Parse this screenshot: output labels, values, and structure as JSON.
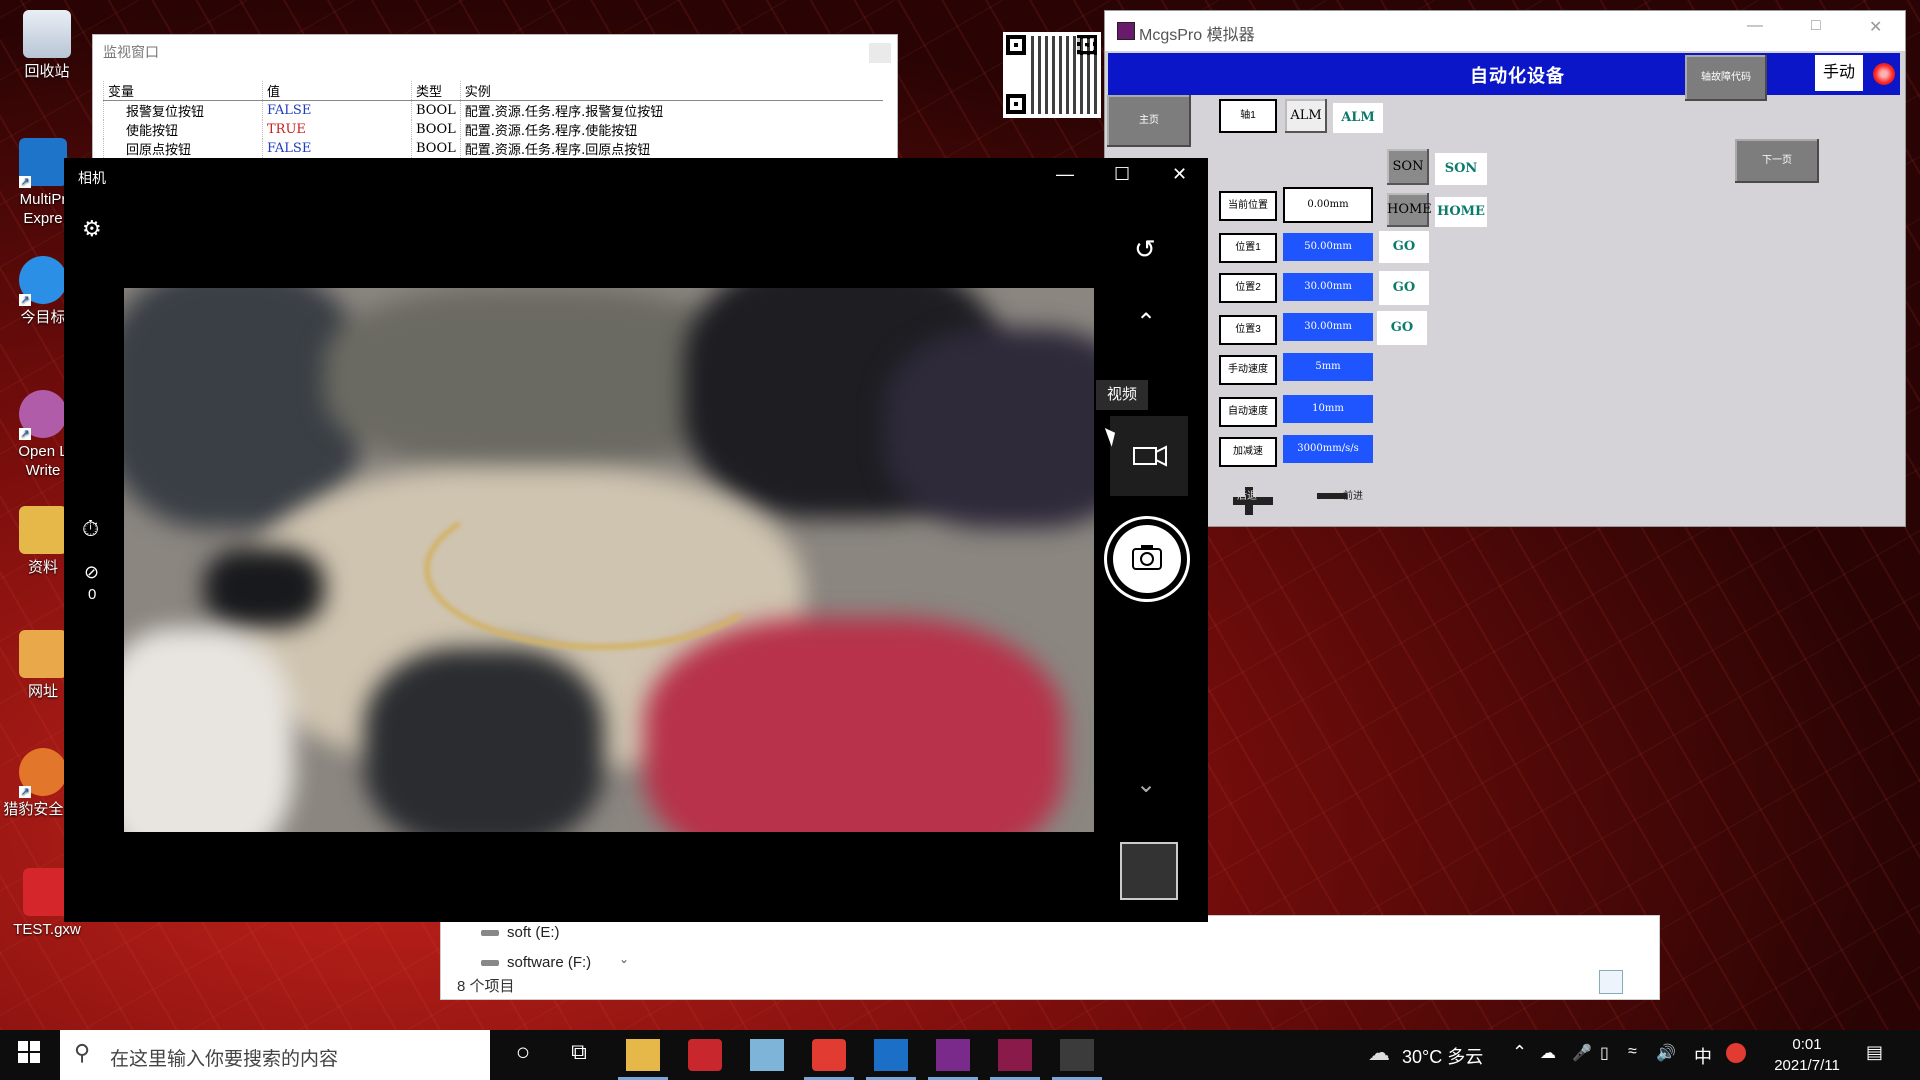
{
  "desktop": {
    "icons": [
      {
        "label": "回收站",
        "icon": "recycle-bin-icon"
      },
      {
        "label": "MultiPr Expre",
        "icon": "multiprog-icon"
      },
      {
        "label": "今目标",
        "icon": "jinmubiao-icon"
      },
      {
        "label": "Open L Write",
        "icon": "openlive-writer-icon"
      },
      {
        "label": "资料",
        "icon": "folder-icon"
      },
      {
        "label": "网址",
        "icon": "url-folder-icon"
      },
      {
        "label": "猎豹安全 器",
        "icon": "cheetah-browser-icon"
      },
      {
        "label": "TEST.gxw",
        "icon": "gxworks-file-icon"
      }
    ]
  },
  "monitor": {
    "title": "监视窗口",
    "headers": [
      "变量",
      "值",
      "类型",
      "实例"
    ],
    "rows": [
      {
        "name": "报警复位按钮",
        "value": "FALSE",
        "type": "BOOL",
        "instance": "配置.资源.任务.程序.报警复位按钮"
      },
      {
        "name": "使能按钮",
        "value": "TRUE",
        "type": "BOOL",
        "instance": "配置.资源.任务.程序.使能按钮"
      },
      {
        "name": "回原点按钮",
        "value": "FALSE",
        "type": "BOOL",
        "instance": "配置.资源.任务.程序.回原点按钮"
      }
    ]
  },
  "explorer": {
    "drives": [
      "soft (E:)",
      "software (F:)"
    ],
    "item_count": "8 个项目"
  },
  "mcgs": {
    "title": "McgsPro 模拟器",
    "banner": "自动化设备",
    "fault_btn": "轴故障代码",
    "mode": "手动",
    "home_btn": "主页",
    "next_btn": "下一页",
    "axis_label": "轴1",
    "alm_a": "ALM",
    "alm_b": "ALM",
    "son_a": "SON",
    "son_b": "SON",
    "home_a": "HOME",
    "home_b": "HOME",
    "current_label": "当前位置",
    "current_value": "0.00mm",
    "positions": [
      {
        "label": "位置1",
        "value": "50.00mm",
        "go": "GO"
      },
      {
        "label": "位置2",
        "value": "30.00mm",
        "go": "GO"
      },
      {
        "label": "位置3",
        "value": "30.00mm",
        "go": "GO"
      }
    ],
    "speeds": [
      {
        "label": "手动速度",
        "value": "5mm"
      },
      {
        "label": "自动速度",
        "value": "10mm"
      },
      {
        "label": "加减速",
        "value": "3000mm/s/s"
      }
    ],
    "jog_fwd": "前进",
    "jog_back": "后退"
  },
  "camera": {
    "title": "相机",
    "tooltip": "视频",
    "timer_count": "0"
  },
  "taskbar": {
    "search_placeholder": "在这里输入你要搜索的内容",
    "weather": "30°C 多云",
    "ime": "中",
    "time": "0:01",
    "date": "2021/7/11"
  }
}
